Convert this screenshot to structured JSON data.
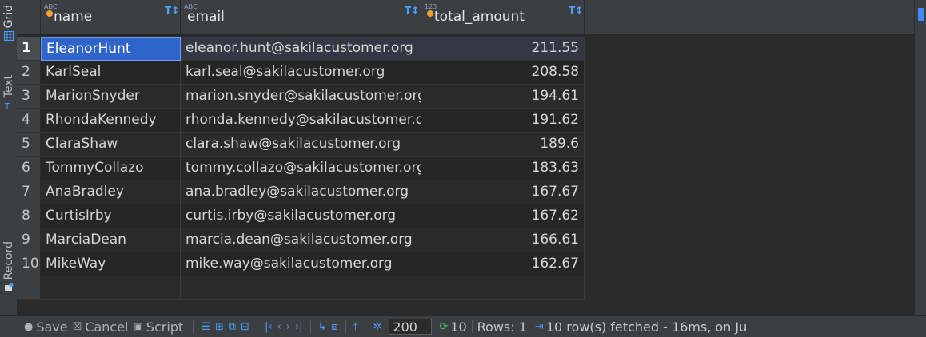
{
  "side_tabs": [
    {
      "label": "Grid",
      "icon": "grid-icon",
      "active": true
    },
    {
      "label": "Text",
      "icon": "text-icon",
      "active": false
    },
    {
      "label": "Record",
      "icon": "record-icon",
      "active": false
    }
  ],
  "columns": [
    {
      "name": "name",
      "type_badge": "ABC"
    },
    {
      "name": "email",
      "type_badge": "ABC"
    },
    {
      "name": "total_amount",
      "type_badge": "123"
    }
  ],
  "rows": [
    {
      "num": "1",
      "name": "EleanorHunt",
      "email": "eleanor.hunt@sakilacustomer.org",
      "total_amount": "211.55"
    },
    {
      "num": "2",
      "name": "KarlSeal",
      "email": "karl.seal@sakilacustomer.org",
      "total_amount": "208.58"
    },
    {
      "num": "3",
      "name": "MarionSnyder",
      "email": "marion.snyder@sakilacustomer.org",
      "total_amount": "194.61"
    },
    {
      "num": "4",
      "name": "RhondaKennedy",
      "email": "rhonda.kennedy@sakilacustomer.org",
      "total_amount": "191.62"
    },
    {
      "num": "5",
      "name": "ClaraShaw",
      "email": "clara.shaw@sakilacustomer.org",
      "total_amount": "189.6"
    },
    {
      "num": "6",
      "name": "TommyCollazo",
      "email": "tommy.collazo@sakilacustomer.org",
      "total_amount": "183.63"
    },
    {
      "num": "7",
      "name": "AnaBradley",
      "email": "ana.bradley@sakilacustomer.org",
      "total_amount": "167.67"
    },
    {
      "num": "8",
      "name": "CurtisIrby",
      "email": "curtis.irby@sakilacustomer.org",
      "total_amount": "167.62"
    },
    {
      "num": "9",
      "name": "MarciaDean",
      "email": "marcia.dean@sakilacustomer.org",
      "total_amount": "166.61"
    },
    {
      "num": "10",
      "name": "MikeWay",
      "email": "mike.way@sakilacustomer.org",
      "total_amount": "162.67"
    }
  ],
  "toolbar": {
    "save_label": "Save",
    "cancel_label": "Cancel",
    "script_label": "Script",
    "fetch_size": "200",
    "fetch_count": "10",
    "rows_label": "Rows: 1",
    "status_text": "10 row(s) fetched - 16ms, on Ju"
  },
  "colors": {
    "selection": "#2f65ca",
    "accent": "#4a9cff",
    "name_dot": "#f0a030"
  }
}
